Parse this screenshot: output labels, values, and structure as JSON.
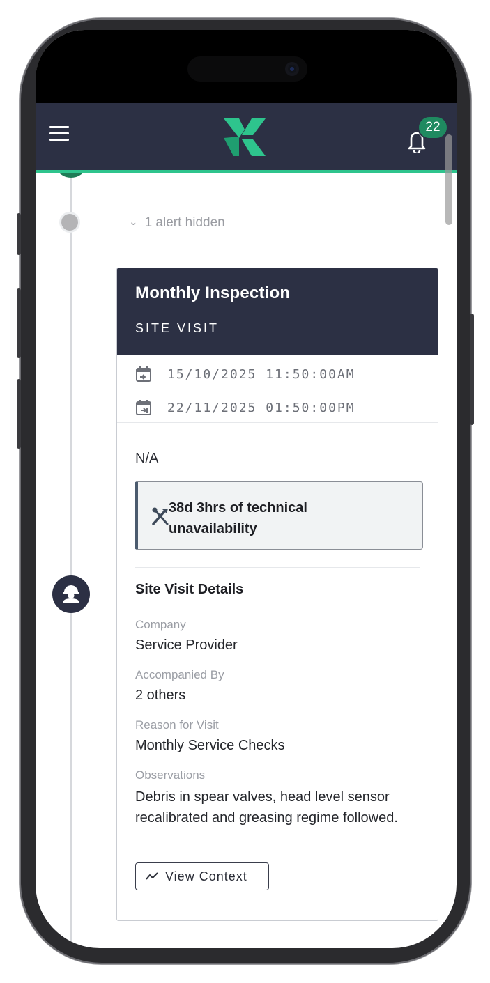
{
  "header": {
    "logo_name": "k-logo",
    "notification_count": "22"
  },
  "timeline": {
    "hidden_alerts": "1 alert hidden"
  },
  "card": {
    "title": "Monthly Inspection",
    "type": "SITE VISIT",
    "start_datetime": "15/10/2025 11:50:00AM",
    "end_datetime": "22/11/2025 01:50:00PM",
    "summary": "N/A",
    "unavailability": "38d 3hrs of technical unavailability",
    "details_title": "Site Visit Details",
    "fields": {
      "company_label": "Company",
      "company_value": "Service Provider",
      "accompanied_label": "Accompanied By",
      "accompanied_value": "2 others",
      "reason_label": "Reason for Visit",
      "reason_value": "Monthly Service Checks",
      "observations_label": "Observations",
      "observations_value": "Debris in spear valves, head level sensor recalibrated and greasing regime followed."
    },
    "view_context_label": "View Context"
  },
  "colors": {
    "appbar": "#2c3044",
    "accent": "#2ec48d",
    "badge": "#1f8a60"
  }
}
